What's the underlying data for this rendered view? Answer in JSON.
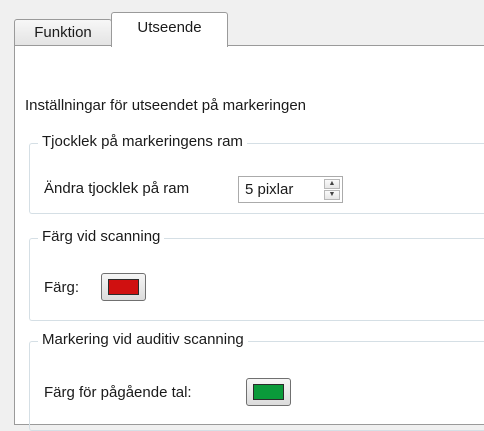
{
  "tabs": [
    {
      "label": "Funktion",
      "active": false
    },
    {
      "label": "Utseende",
      "active": true
    }
  ],
  "panel": {
    "heading": "Inställningar för utseendet på markeringen",
    "frame_thickness": {
      "legend": "Tjocklek på markeringens ram",
      "label": "Ändra tjocklek på ram",
      "value": "5 pixlar",
      "up_icon": "arrow-up-icon",
      "down_icon": "arrow-down-icon"
    },
    "scan_color": {
      "legend": "Färg vid scanning",
      "label": "Färg:",
      "color": "#d01010"
    },
    "auditory_scanning": {
      "legend": "Markering vid auditiv scanning",
      "label": "Färg för pågående tal:",
      "color": "#0a9a3a"
    }
  }
}
